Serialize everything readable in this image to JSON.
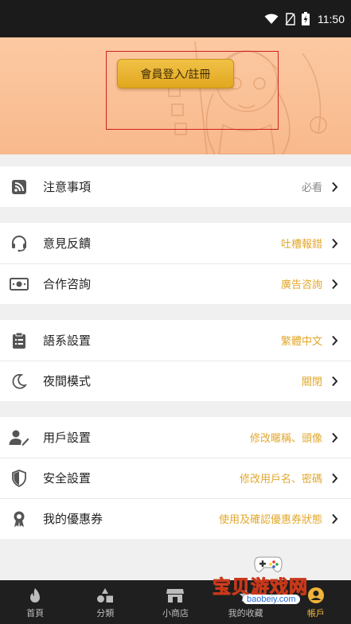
{
  "status_bar": {
    "time": "11:50"
  },
  "banner": {
    "login_button": "會員登入/註冊"
  },
  "sections": [
    {
      "rows": [
        {
          "icon": "rss-icon",
          "label": "注意事項",
          "value": "必看",
          "value_style": "gray"
        }
      ]
    },
    {
      "rows": [
        {
          "icon": "headset-icon",
          "label": "意見反饋",
          "value": "吐槽報錯",
          "value_style": "accent"
        },
        {
          "icon": "cash-icon",
          "label": "合作咨詢",
          "value": "廣告咨詢",
          "value_style": "accent"
        }
      ]
    },
    {
      "rows": [
        {
          "icon": "clipboard-icon",
          "label": "語系設置",
          "value": "繁體中文",
          "value_style": "accent"
        },
        {
          "icon": "moon-icon",
          "label": "夜間模式",
          "value": "關閉",
          "value_style": "accent"
        }
      ]
    },
    {
      "rows": [
        {
          "icon": "user-edit-icon",
          "label": "用戶設置",
          "value": "修改暱稱、頭像",
          "value_style": "accent"
        },
        {
          "icon": "shield-icon",
          "label": "安全設置",
          "value": "修改用戶名、密碼",
          "value_style": "accent"
        },
        {
          "icon": "award-icon",
          "label": "我的優惠券",
          "value": "使用及確認優惠券狀態",
          "value_style": "accent"
        }
      ]
    }
  ],
  "tabs": [
    {
      "icon": "flame-icon",
      "label": "首頁",
      "active": false
    },
    {
      "icon": "shapes-icon",
      "label": "分類",
      "active": false
    },
    {
      "icon": "store-icon",
      "label": "小商店",
      "active": false
    },
    {
      "icon": "collection-icon",
      "label": "我的收藏",
      "active": false
    },
    {
      "icon": "account-icon",
      "label": "帳戶",
      "active": true
    }
  ],
  "watermark": {
    "title": "宝贝游戏网",
    "url": "baobeiy.com"
  },
  "colors": {
    "accent": "#e2a72c",
    "banner": "#fbc49c",
    "button": "#e9b533",
    "tab_active": "#f0b43a",
    "tab_bar": "#1f1f1f"
  }
}
